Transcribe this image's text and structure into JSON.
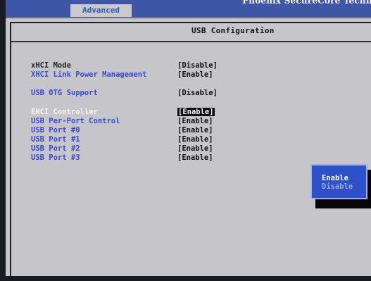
{
  "vendor_text": "Phoenix SecureCore Techno",
  "tab": {
    "label": "Advanced"
  },
  "page": {
    "title": "USB Configuration"
  },
  "settings": [
    {
      "label": "xHCI Mode",
      "value": "[Disable]"
    },
    {
      "label": "XHCI Link Power Management",
      "value": "[Enable]"
    },
    {
      "label": "USB OTG Support",
      "value": "[Disable]"
    },
    {
      "label": "EHCI Controller",
      "value": "[Enable]"
    },
    {
      "label": "USB Per-Port Control",
      "value": "[Enable]"
    },
    {
      "label": "USB Port #0",
      "value": "[Enable]"
    },
    {
      "label": "USB Port #1",
      "value": "[Enable]"
    },
    {
      "label": "USB Port #2",
      "value": "[Enable]"
    },
    {
      "label": "USB Port #3",
      "value": "[Enable]"
    }
  ],
  "popup": {
    "options": [
      "Enable",
      "Disable"
    ],
    "selected": "Enable"
  },
  "colors": {
    "bios_gray": "#c6c5c9",
    "highlight_blue": "#3a48cf",
    "popup_blue": "#2e50c8"
  }
}
